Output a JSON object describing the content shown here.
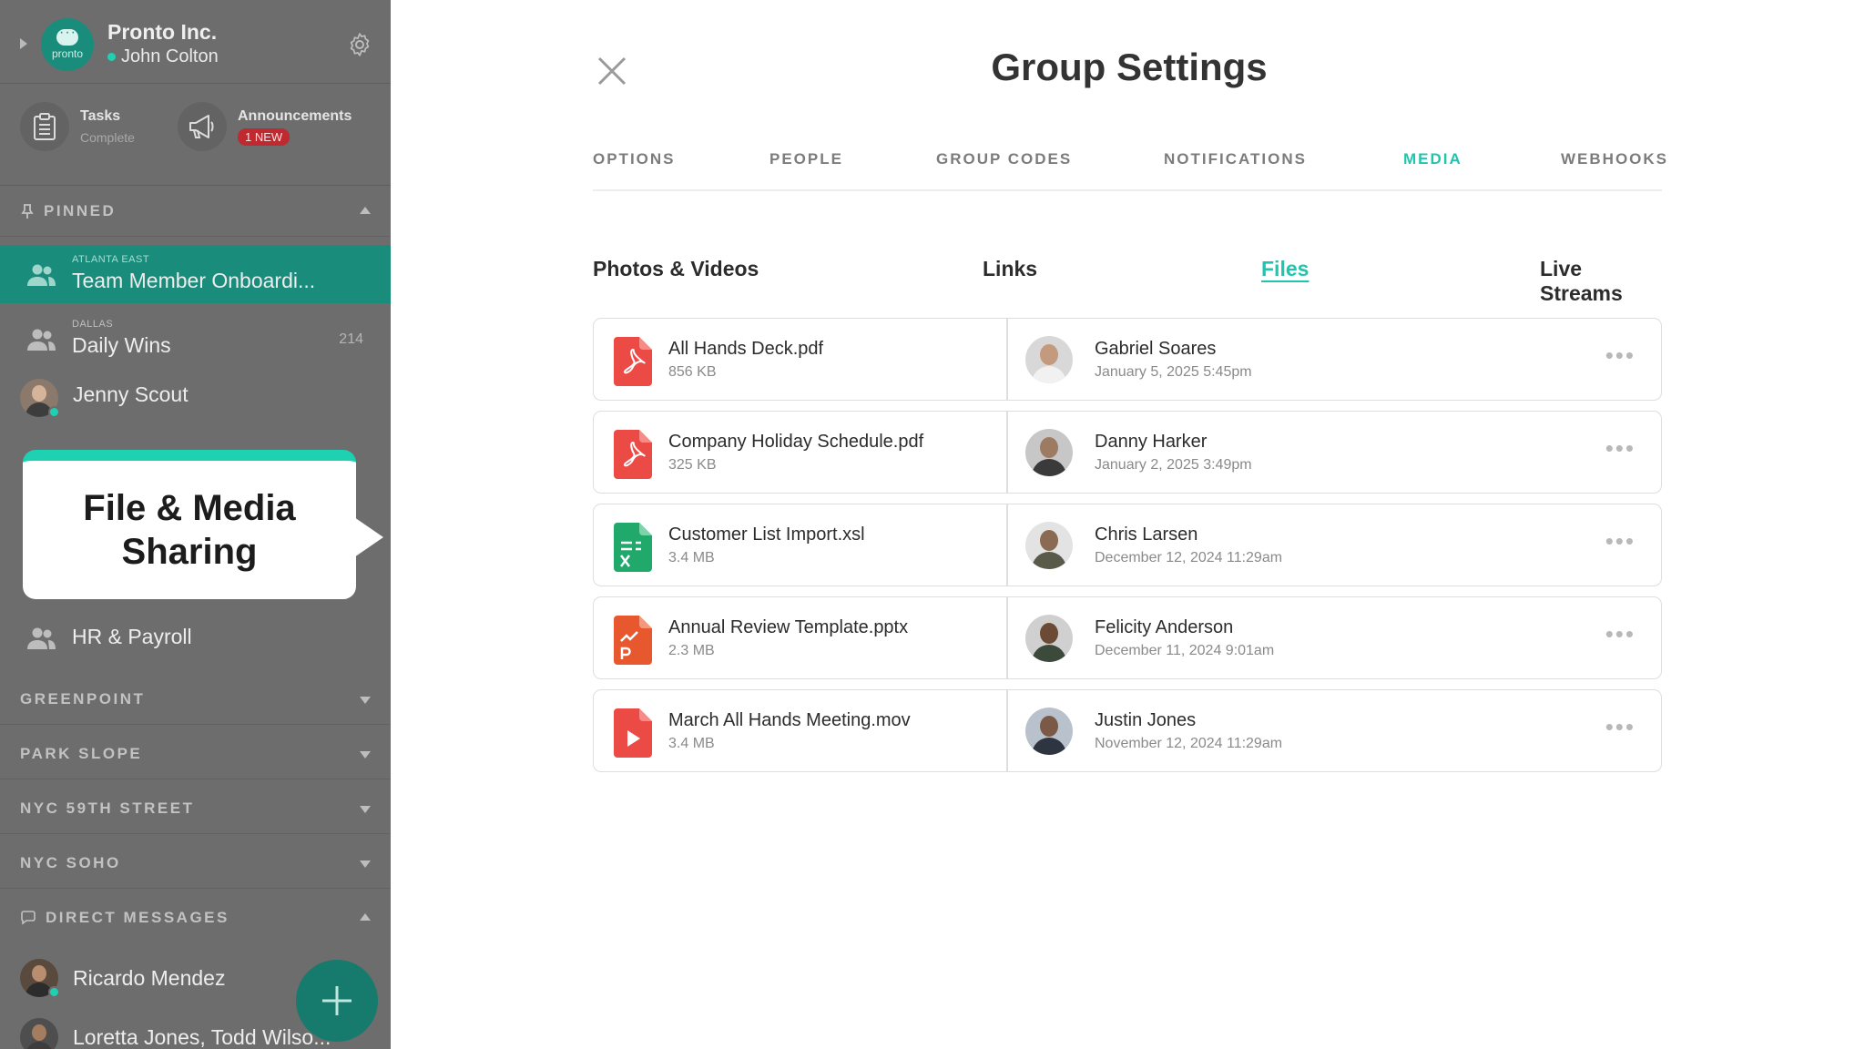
{
  "sidebar": {
    "org_name": "Pronto Inc.",
    "user_name": "John Colton",
    "logo_text": "pronto",
    "quick": {
      "tasks_title": "Tasks",
      "tasks_sub": "Complete",
      "announcements_title": "Announcements",
      "announcements_badge": "1 NEW"
    },
    "pinned_label": "PINNED",
    "pinned": [
      {
        "location": "ATLANTA EAST",
        "name": "Team Member Onboardi..."
      },
      {
        "location": "DALLAS",
        "name": "Daily Wins",
        "count": "214"
      }
    ],
    "dm_pinned": "Jenny Scout",
    "hr_group": "HR & Payroll",
    "sections": [
      "GREENPOINT",
      "PARK SLOPE",
      "NYC 59TH STREET",
      "NYC SOHO"
    ],
    "dm_label": "DIRECT MESSAGES",
    "direct_messages": [
      "Ricardo Mendez",
      "Loretta Jones, Todd Wilso..."
    ]
  },
  "callout": {
    "text": "File & Media Sharing"
  },
  "main": {
    "title": "Group Settings",
    "tabs": [
      "OPTIONS",
      "PEOPLE",
      "GROUP CODES",
      "NOTIFICATIONS",
      "MEDIA",
      "WEBHOOKS"
    ],
    "active_tab": "MEDIA",
    "subtabs": [
      "Photos & Videos",
      "Links",
      "Files",
      "Live Streams"
    ],
    "active_subtab": "Files",
    "files": [
      {
        "name": "All Hands Deck.pdf",
        "size": "856 KB",
        "type": "pdf",
        "owner": "Gabriel Soares",
        "date": "January 5, 2025 5:45pm"
      },
      {
        "name": "Company Holiday Schedule.pdf",
        "size": "325 KB",
        "type": "pdf",
        "owner": "Danny Harker",
        "date": "January 2, 2025 3:49pm"
      },
      {
        "name": "Customer List Import.xsl",
        "size": "3.4 MB",
        "type": "xls",
        "owner": "Chris Larsen",
        "date": "December 12, 2024 11:29am"
      },
      {
        "name": "Annual Review Template.pptx",
        "size": "2.3 MB",
        "type": "ppt",
        "owner": "Felicity Anderson",
        "date": "December 11, 2024 9:01am"
      },
      {
        "name": "March All Hands Meeting.mov",
        "size": "3.4 MB",
        "type": "video",
        "owner": "Justin Jones",
        "date": "November 12, 2024 11:29am"
      }
    ]
  },
  "colors": {
    "accent": "#1fc6ad",
    "sidebar_bg": "#6d6d6d",
    "active_group": "#1a8c7c",
    "pdf_red": "#ec4a45",
    "xls_green": "#21a86b",
    "ppt_orange": "#e8582f"
  }
}
